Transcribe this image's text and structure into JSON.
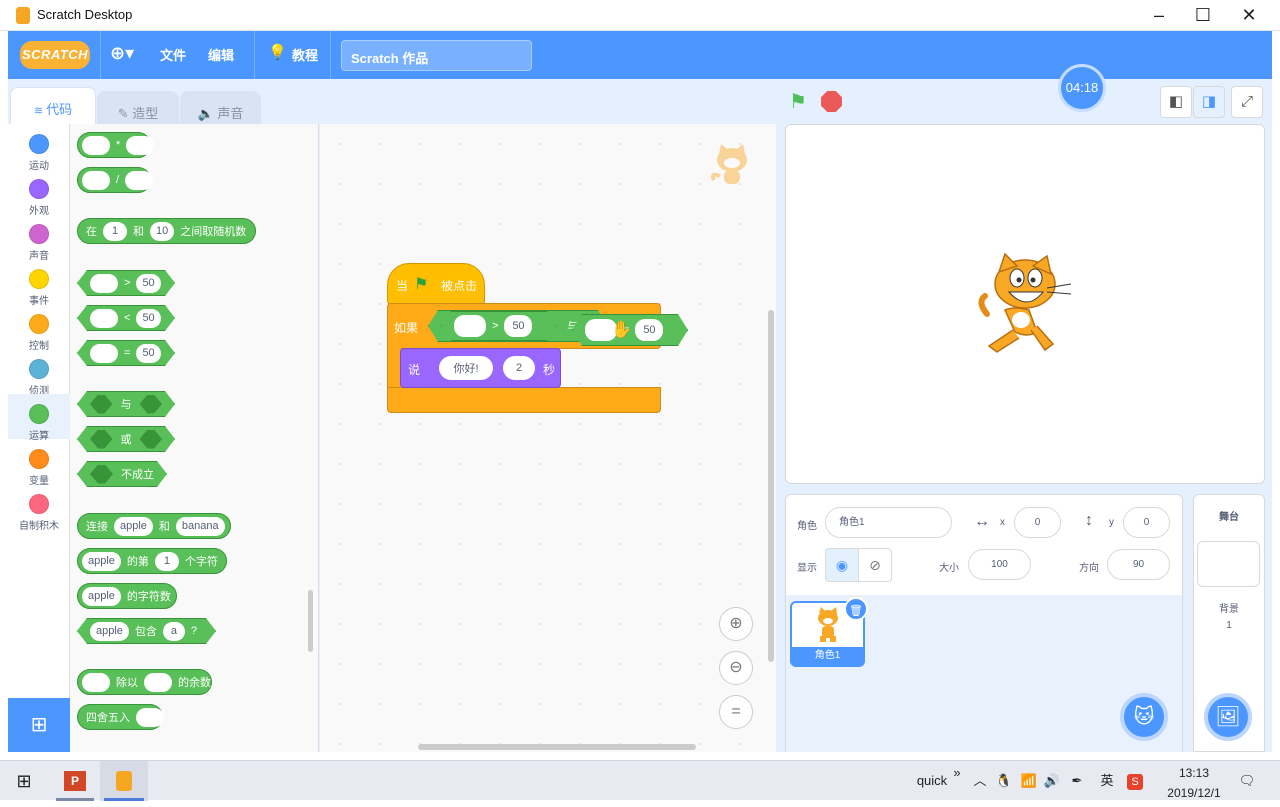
{
  "window": {
    "title": "Scratch Desktop"
  },
  "menu": {
    "logo": "SCRATCH",
    "file": "文件",
    "edit": "编辑",
    "tutorials": "教程",
    "project_title": "Scratch 作品"
  },
  "tabs": {
    "code": "代码",
    "costumes": "造型",
    "sounds": "声音"
  },
  "categories": [
    "运动",
    "外观",
    "声音",
    "事件",
    "控制",
    "侦测",
    "运算",
    "变量",
    "自制积木"
  ],
  "category_colors": [
    "#4c97ff",
    "#9966ff",
    "#cf63cf",
    "#ffd500",
    "#ffab19",
    "#5cb1d6",
    "#59c059",
    "#ff8c1a",
    "#ff6680"
  ],
  "palette": {
    "multiply": "*",
    "divide": "/",
    "random": {
      "prefix": "在",
      "from": "1",
      "and": "和",
      "to": "10",
      "suffix": "之间取随机数"
    },
    "gt": {
      "op": ">",
      "value": "50"
    },
    "lt": {
      "op": "<",
      "value": "50"
    },
    "eq": {
      "op": "=",
      "value": "50"
    },
    "and": "与",
    "or": "或",
    "not": "不成立",
    "join": {
      "prefix": "连接",
      "a": "apple",
      "and": "和",
      "b": "banana"
    },
    "letter_of": {
      "word": "apple",
      "mid": "的第",
      "index": "1",
      "suffix": "个字符"
    },
    "length": {
      "word": "apple",
      "suffix": "的字符数"
    },
    "contains": {
      "word": "apple",
      "mid": "包含",
      "value": "a",
      "suffix": "?"
    },
    "mod": {
      "mid": "除以",
      "suffix": "的余数"
    },
    "round": "四舍五入"
  },
  "script": {
    "event": {
      "when": "当",
      "clicked": "被点击"
    },
    "if": {
      "label": "如果",
      "gt_op": ">",
      "gt_value": "50",
      "and": "与"
    },
    "drag_block": {
      "op": "=",
      "value": "50"
    },
    "say": {
      "label": "说",
      "text": "你好!",
      "secs": "2",
      "unit": "秒"
    }
  },
  "stage": {
    "timer": "04:18"
  },
  "sprite_info": {
    "sprite_label": "角色",
    "sprite_name": "角色1",
    "x_label": "x",
    "x": "0",
    "y_label": "y",
    "y": "0",
    "show_label": "显示",
    "size_label": "大小",
    "size": "100",
    "direction_label": "方向",
    "direction": "90"
  },
  "sprites": [
    {
      "name": "角色1"
    }
  ],
  "stage_panel": {
    "title": "舞台",
    "backdrops_label": "背景",
    "backdrops_count": "1"
  },
  "taskbar": {
    "quick": "quick",
    "chevron": "»",
    "ime": "英",
    "time": "13:13",
    "date": "2019/12/1"
  }
}
